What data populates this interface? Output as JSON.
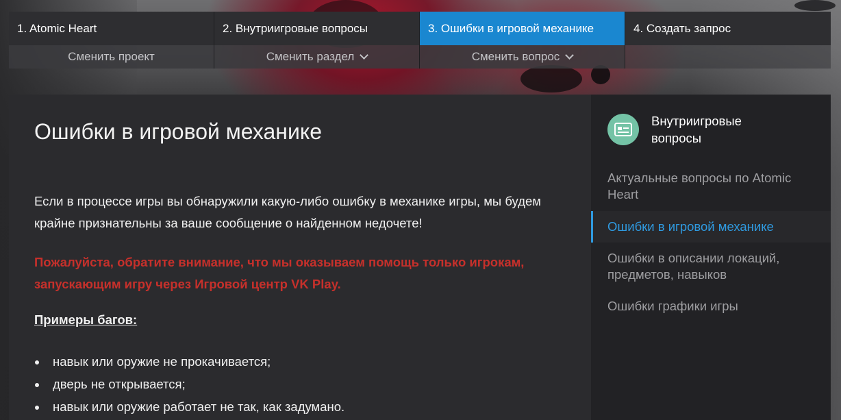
{
  "stepper": {
    "steps": [
      {
        "label": "1. Atomic Heart",
        "sub": "Сменить проект",
        "sub_dropdown": false,
        "active": false
      },
      {
        "label": "2. Внутриигровые вопросы",
        "sub": "Сменить раздел",
        "sub_dropdown": true,
        "active": false
      },
      {
        "label": "3. Ошибки в игровой механике",
        "sub": "Сменить вопрос",
        "sub_dropdown": true,
        "active": true
      },
      {
        "label": "4. Создать запрос",
        "sub": "",
        "sub_dropdown": false,
        "active": false
      }
    ]
  },
  "article": {
    "title": "Ошибки в игровой механике",
    "intro": "Если в процессе игры вы обнаружили какую-либо ошибку в механике игры, мы будем крайне признательны за ваше сообщение о найденном недочете!",
    "warning": "Пожалуйста, обратите внимание, что мы оказываем помощь только игрокам, запускающим игру через Игровой центр VK Play.",
    "examples_title": "Примеры багов:",
    "examples": [
      "навык или оружие не прокачивается;",
      "дверь не открывается;",
      "навык или оружие работает не так, как задумано."
    ]
  },
  "sidebar": {
    "title": "Внутриигровые вопросы",
    "icon": "id-card-icon",
    "items": [
      {
        "label": "Актуальные вопросы по Atomic Heart",
        "active": false
      },
      {
        "label": "Ошибки в игровой механике",
        "active": true
      },
      {
        "label": "Ошибки в описании локаций, предметов, навыков",
        "active": false
      },
      {
        "label": "Ошибки графики игры",
        "active": false
      }
    ]
  },
  "colors": {
    "accent": "#1a87d0",
    "warning": "#c6302b",
    "sidebar_icon_bg": "#74c3a6"
  }
}
